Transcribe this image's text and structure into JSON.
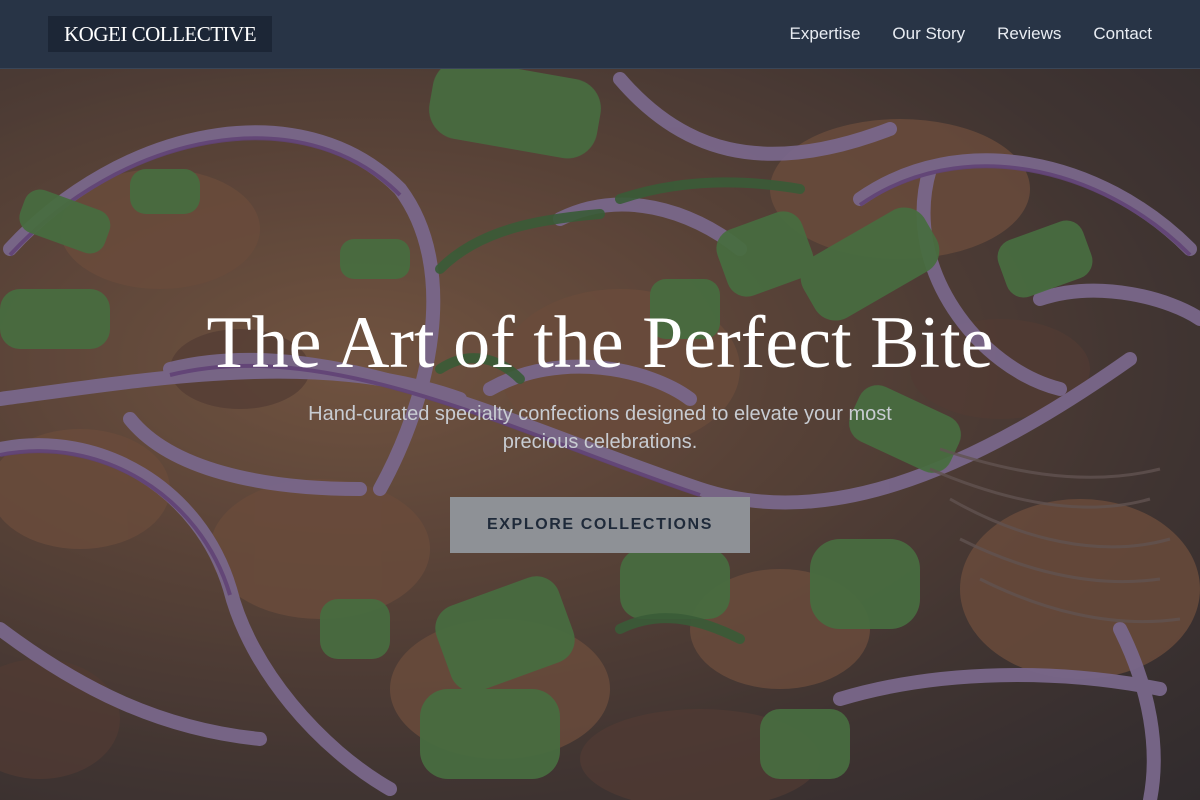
{
  "header": {
    "logo": "KOGEI COLLECTIVE",
    "nav": [
      {
        "label": "Expertise"
      },
      {
        "label": "Our Story"
      },
      {
        "label": "Reviews"
      },
      {
        "label": "Contact"
      }
    ]
  },
  "hero": {
    "title": "The Art of the Perfect Bite",
    "subtitle": "Hand-curated specialty confections designed to elevate your most precious celebrations.",
    "cta_label": "EXPLORE COLLECTIONS",
    "background_image": "food-dish-red-onion-scallion-photo"
  },
  "colors": {
    "header_bg": "#283446",
    "logo_bg": "#1c2636",
    "cta_bg": "#8e9196",
    "cta_text": "#1f2a3a"
  }
}
